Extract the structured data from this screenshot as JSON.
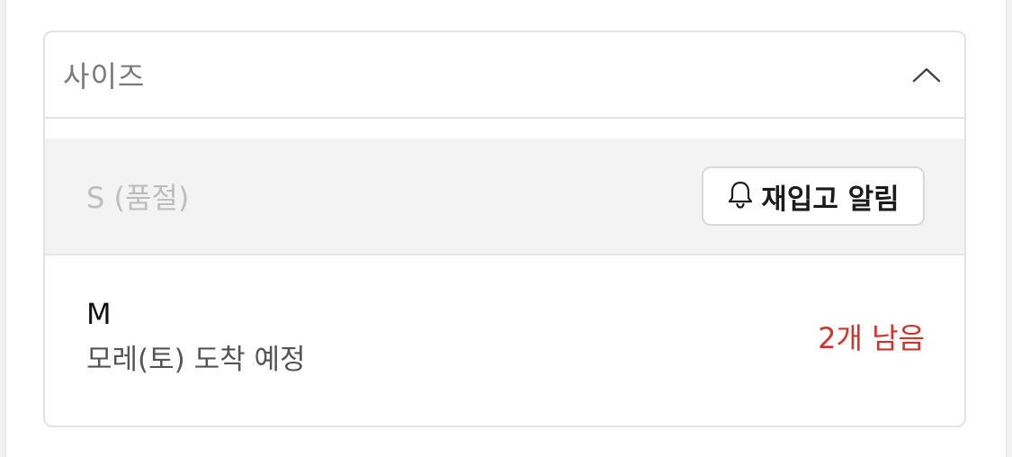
{
  "size_selector": {
    "title": "사이즈",
    "toggle_icon": "chevron-up-icon",
    "options": [
      {
        "label": "S (품절)",
        "status": "soldout",
        "restock_button": {
          "icon": "bell-icon",
          "label": "재입고 알림"
        }
      },
      {
        "label": "M",
        "status": "available",
        "eta": "모레(토) 도착 예정",
        "stock_note": "2개 남음"
      }
    ]
  },
  "colors": {
    "stock_warning": "#d0342c",
    "soldout_text": "#bdbdbd",
    "soldout_bg": "#f3f3f3",
    "border": "#e3e3e3"
  }
}
